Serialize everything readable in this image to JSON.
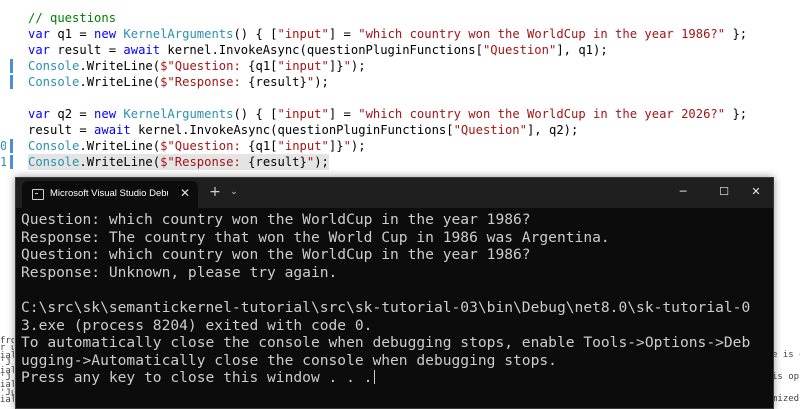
{
  "editor": {
    "lines": [
      {
        "gutter": "",
        "changed": false,
        "highlighted": false,
        "tokens": [
          {
            "t": "// questions",
            "c": "cm"
          }
        ]
      },
      {
        "gutter": "",
        "changed": false,
        "highlighted": false,
        "tokens": [
          {
            "t": "var",
            "c": "kw"
          },
          {
            "t": " q1 = ",
            "c": ""
          },
          {
            "t": "new",
            "c": "kw"
          },
          {
            "t": " ",
            "c": ""
          },
          {
            "t": "KernelArguments",
            "c": "ty"
          },
          {
            "t": "() { [",
            "c": ""
          },
          {
            "t": "\"input\"",
            "c": "st"
          },
          {
            "t": "] = ",
            "c": ""
          },
          {
            "t": "\"which country won the WorldCup in the year 1986?\"",
            "c": "st"
          },
          {
            "t": " };",
            "c": ""
          }
        ]
      },
      {
        "gutter": "",
        "changed": false,
        "highlighted": false,
        "tokens": [
          {
            "t": "var",
            "c": "kw"
          },
          {
            "t": " result = ",
            "c": ""
          },
          {
            "t": "await",
            "c": "kw"
          },
          {
            "t": " kernel.InvokeAsync(questionPluginFunctions[",
            "c": ""
          },
          {
            "t": "\"Question\"",
            "c": "st"
          },
          {
            "t": "], q1);",
            "c": ""
          }
        ]
      },
      {
        "gutter": "",
        "changed": true,
        "highlighted": false,
        "tokens": [
          {
            "t": "Console",
            "c": "ty"
          },
          {
            "t": ".WriteLine(",
            "c": ""
          },
          {
            "t": "$\"Question: ",
            "c": "st"
          },
          {
            "t": "{q1[",
            "c": ""
          },
          {
            "t": "\"input\"",
            "c": "st"
          },
          {
            "t": "]}",
            "c": ""
          },
          {
            "t": "\"",
            "c": "st"
          },
          {
            "t": ");",
            "c": ""
          }
        ]
      },
      {
        "gutter": "",
        "changed": true,
        "highlighted": false,
        "tokens": [
          {
            "t": "Console",
            "c": "ty"
          },
          {
            "t": ".WriteLine(",
            "c": ""
          },
          {
            "t": "$\"Response: ",
            "c": "st"
          },
          {
            "t": "{result}",
            "c": ""
          },
          {
            "t": "\"",
            "c": "st"
          },
          {
            "t": ");",
            "c": ""
          }
        ]
      },
      {
        "gutter": "",
        "changed": false,
        "highlighted": false,
        "tokens": []
      },
      {
        "gutter": "",
        "changed": false,
        "highlighted": false,
        "tokens": [
          {
            "t": "var",
            "c": "kw"
          },
          {
            "t": " q2 = ",
            "c": ""
          },
          {
            "t": "new",
            "c": "kw"
          },
          {
            "t": " ",
            "c": ""
          },
          {
            "t": "KernelArguments",
            "c": "ty"
          },
          {
            "t": "() { [",
            "c": ""
          },
          {
            "t": "\"input\"",
            "c": "st"
          },
          {
            "t": "] = ",
            "c": ""
          },
          {
            "t": "\"which country won the WorldCup in the year 2026?\"",
            "c": "st"
          },
          {
            "t": " };",
            "c": ""
          }
        ]
      },
      {
        "gutter": "",
        "changed": false,
        "highlighted": false,
        "tokens": [
          {
            "t": "result = ",
            "c": ""
          },
          {
            "t": "await",
            "c": "kw"
          },
          {
            "t": " kernel.InvokeAsync(questionPluginFunctions[",
            "c": ""
          },
          {
            "t": "\"Question\"",
            "c": "st"
          },
          {
            "t": "], q2);",
            "c": ""
          }
        ]
      },
      {
        "gutter": "0",
        "changed": true,
        "highlighted": false,
        "tokens": [
          {
            "t": "Console",
            "c": "ty"
          },
          {
            "t": ".WriteLine(",
            "c": ""
          },
          {
            "t": "$\"Question: ",
            "c": "st"
          },
          {
            "t": "{q1[",
            "c": ""
          },
          {
            "t": "\"input\"",
            "c": "st"
          },
          {
            "t": "]}",
            "c": ""
          },
          {
            "t": "\"",
            "c": "st"
          },
          {
            "t": ");",
            "c": ""
          }
        ]
      },
      {
        "gutter": "1",
        "changed": true,
        "highlighted": true,
        "tokens": [
          {
            "t": "Console",
            "c": "ty"
          },
          {
            "t": ".WriteLine(",
            "c": ""
          },
          {
            "t": "$\"Response: ",
            "c": "st"
          },
          {
            "t": "{result}",
            "c": ""
          },
          {
            "t": "\"",
            "c": "st"
          },
          {
            "t": ");",
            "c": ""
          }
        ]
      }
    ]
  },
  "left_pane": {
    "lines": [
      "fro",
      "r u",
      "ial",
      "'J",
      "ial",
      "'J",
      "ial",
      "'Ju",
      "ial"
    ]
  },
  "right_pane": {
    "lines": [
      "e is op",
      "",
      "is op",
      "",
      "mized"
    ]
  },
  "terminal": {
    "tab_title": "Microsoft Visual Studio Debug Console",
    "close_tab_glyph": "✕",
    "new_tab_glyph": "+",
    "dropdown_glyph": "⌄",
    "minimize_glyph": "─",
    "maximize_glyph": "☐",
    "close_glyph": "✕",
    "output": [
      "Question: which country won the WorldCup in the year 1986?",
      "Response: The country that won the World Cup in 1986 was Argentina.",
      "Question: which country won the WorldCup in the year 1986?",
      "Response: Unknown, please try again.",
      "",
      "C:\\src\\sk\\semantickernel-tutorial\\src\\sk-tutorial-03\\bin\\Debug\\net8.0\\sk-tutorial-0",
      "3.exe (process 8204) exited with code 0.",
      "To automatically close the console when debugging stops, enable Tools->Options->Deb",
      "ugging->Automatically close the console when debugging stops.",
      "Press any key to close this window . . ."
    ]
  }
}
